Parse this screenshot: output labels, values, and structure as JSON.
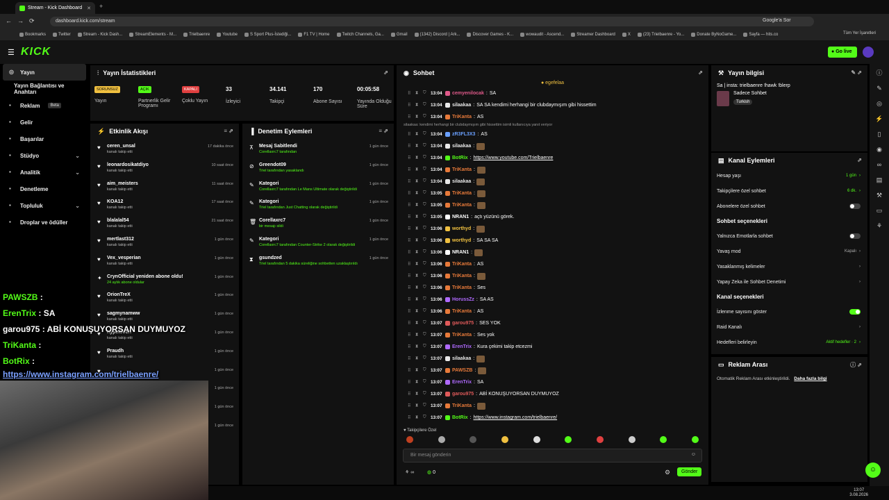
{
  "browser": {
    "tab_title": "Stream - Kick Dashboard",
    "url": "dashboard.kick.com/stream",
    "google_btn": "Google'a Sor",
    "all_bookmarks": "Tüm Yer İşaretleri",
    "bookmarks": [
      "Bookmarks",
      "Twitter",
      "Stream - Kick Dash...",
      "StreamElements - M...",
      "Trielbaenre",
      "Youtube",
      "S Sport Plus-İstediği...",
      "F1 TV | Home",
      "Twitch Channels, Ga...",
      "Gmail",
      "(1342) Discord | Ark...",
      "Discover Games - K...",
      "wowaudit - Ascend...",
      "Streamer Dashboard",
      "X",
      "(23) Trielbaenre - Yo...",
      "Donate ByNoGame...",
      "Sayfa — hits.co"
    ]
  },
  "header": {
    "logo": "KICK",
    "go_live": "Go live"
  },
  "sidebar": {
    "items": [
      {
        "label": "Yayın",
        "icon": "broadcast-icon"
      },
      {
        "label": "Yayın Bağlantısı ve Anahtarı",
        "icon": ""
      },
      {
        "label": "Reklam",
        "badge": "Beta",
        "icon": "ad-icon"
      },
      {
        "label": "Gelir",
        "icon": "wallet-icon"
      },
      {
        "label": "Başarılar",
        "icon": "trophy-icon"
      },
      {
        "label": "Stüdyo",
        "icon": "studio-icon"
      },
      {
        "label": "Analitik",
        "icon": "chart-icon"
      },
      {
        "label": "Denetleme",
        "icon": "shield-icon"
      },
      {
        "label": "Topluluk",
        "icon": "community-icon"
      },
      {
        "label": "Droplar ve ödüller",
        "icon": "gift-icon"
      }
    ]
  },
  "stats": {
    "title": "Yayın İstatistikleri",
    "items": [
      {
        "tag": "SORUNSUZ",
        "label": "Yayın"
      },
      {
        "tag": "AÇIK",
        "label": "Partnerlik Gelir Programı"
      },
      {
        "tag": "KAPALI",
        "label": "Çoklu Yayın"
      },
      {
        "value": "33",
        "label": "İzleyici"
      },
      {
        "value": "34.141",
        "label": "Takipçi"
      },
      {
        "value": "170",
        "label": "Abone Sayısı"
      },
      {
        "value": "00:05:58",
        "label": "Yayında Olduğu Süre"
      }
    ]
  },
  "activity": {
    "title": "Etkinlik Akışı",
    "items": [
      {
        "name": "ceren_unsal",
        "sub": "kanalı takip etti",
        "time": "17 dakika önce"
      },
      {
        "name": "leonardosikatdiyo",
        "sub": "kanalı takip etti",
        "time": "10 saat önce"
      },
      {
        "name": "aim_meisters",
        "sub": "kanalı takip etti",
        "time": "11 saat önce"
      },
      {
        "name": "KOA12",
        "sub": "kanalı takip etti",
        "time": "17 saat önce"
      },
      {
        "name": "blalalal54",
        "sub": "kanalı takip etti",
        "time": "21 saat önce"
      },
      {
        "name": "mertlast312",
        "sub": "kanalı takip etti",
        "time": "1 gün önce"
      },
      {
        "name": "Vex_vesperian",
        "sub": "kanalı takip etti",
        "time": "1 gün önce"
      },
      {
        "name": "CrynOfficial yeniden abone oldu!",
        "sub": "24 aylık abone oldular",
        "time": "1 gün önce"
      },
      {
        "name": "OrionTreX",
        "sub": "kanalı takip etti",
        "time": "1 gün önce"
      },
      {
        "name": "sagmynamww",
        "sub": "kanalı takip etti",
        "time": "1 gün önce"
      },
      {
        "name": "hypeloveri",
        "sub": "kanalı takip etti",
        "time": "1 gün önce"
      },
      {
        "name": "Praudh",
        "sub": "kanalı takip etti",
        "time": "1 gün önce"
      },
      {
        "name": "",
        "sub": "",
        "time": "1 gün önce"
      },
      {
        "name": "",
        "sub": "",
        "time": "1 gün önce"
      },
      {
        "name": "",
        "sub": "",
        "time": "1 gün önce"
      },
      {
        "name": "",
        "sub": "",
        "time": "1 gün önce"
      }
    ]
  },
  "moderation": {
    "title": "Denetim Eylemleri",
    "items": [
      {
        "title": "Mesaj Sabitlendi",
        "sub": "Corellaxrc7 tarafından",
        "time": "1 gün önce"
      },
      {
        "title": "Greendot09",
        "sub": "Triel tarafından yasaklandı",
        "time": "1 gün önce"
      },
      {
        "title": "Kategori",
        "sub": "Corellaxrc7 tarafından Le Mans Ultimate olarak değiştirildi",
        "time": "1 gün önce"
      },
      {
        "title": "Kategori",
        "sub": "Triel tarafından Just Chatting olarak değiştirildi",
        "time": "1 gün önce"
      },
      {
        "title": "Corellaxrc7",
        "sub": "bir mesajı sildi",
        "time": "1 gün önce"
      },
      {
        "title": "Kategori",
        "sub": "Corellaxrc7 tarafından Counter-Strike 2 olarak değiştirildi",
        "time": "1 gün önce"
      },
      {
        "title": "gsundzed",
        "sub": "Triel tarafından 5 dakika süreliğine sohbetten uzaklaştırıldı",
        "time": "1 gün önce"
      }
    ]
  },
  "chat": {
    "title": "Sohbet",
    "pinned_user": "egefelaa",
    "reply_note": "silaakaa: kendimi herhangi bir clubdaymışım gibi hissettim isimli kullanıcıya yanıt veriyor",
    "placeholder": "Bir mesaj gönderin",
    "send": "Gönder",
    "followers_label": "Takipçilere Özel",
    "count": "0",
    "messages": [
      {
        "time": "13:04",
        "user": "cemyenilocak",
        "color": "#e05a8a",
        "text": "SA"
      },
      {
        "time": "13:04",
        "user": "silaakaa",
        "color": "#e8e8e8",
        "text": "SA SA  kendimi herhangi bir clubdaymışım gibi hissettim"
      },
      {
        "time": "13:04",
        "user": "TriKanta",
        "color": "#e87a3a",
        "text": "AS"
      },
      {
        "time": "13:04",
        "user": "zR3FL3X3",
        "color": "#6aa0ff",
        "text": "AS"
      },
      {
        "time": "13:04",
        "user": "silaakaa",
        "color": "#e8e8e8",
        "text": ""
      },
      {
        "time": "13:04",
        "user": "BotRix",
        "color": "#53fc18",
        "text": "https://www.youtube.com/Trielbaenre",
        "link": true
      },
      {
        "time": "13:04",
        "user": "TriKanta",
        "color": "#e87a3a",
        "text": ""
      },
      {
        "time": "13:04",
        "user": "silaakaa",
        "color": "#e8e8e8",
        "text": ""
      },
      {
        "time": "13:05",
        "user": "TriKanta",
        "color": "#e87a3a",
        "text": ""
      },
      {
        "time": "13:05",
        "user": "TriKanta",
        "color": "#e87a3a",
        "text": ""
      },
      {
        "time": "13:05",
        "user": "NRAN1",
        "color": "#ffffff",
        "text": "açtı yüzünü görek."
      },
      {
        "time": "13:06",
        "user": "worthyd",
        "color": "#f0c040",
        "text": ""
      },
      {
        "time": "13:06",
        "user": "worthyd",
        "color": "#f0c040",
        "text": "SA SA SA"
      },
      {
        "time": "13:06",
        "user": "NRAN1",
        "color": "#ffffff",
        "text": ""
      },
      {
        "time": "13:06",
        "user": "TriKanta",
        "color": "#e87a3a",
        "text": "AS"
      },
      {
        "time": "13:06",
        "user": "TriKanta",
        "color": "#e87a3a",
        "text": ""
      },
      {
        "time": "13:06",
        "user": "TriKanta",
        "color": "#e87a3a",
        "text": "Ses"
      },
      {
        "time": "13:06",
        "user": "HorussZz",
        "color": "#b06aff",
        "text": "SA AS"
      },
      {
        "time": "13:06",
        "user": "TriKanta",
        "color": "#e87a3a",
        "text": "AS"
      },
      {
        "time": "13:07",
        "user": "garou975",
        "color": "#e05a5a",
        "text": "SES YOK"
      },
      {
        "time": "13:07",
        "user": "TriKanta",
        "color": "#e87a3a",
        "text": "Ses yok"
      },
      {
        "time": "13:07",
        "user": "ErenTrix",
        "color": "#b06aff",
        "text": "Kura çekimi takip etcezmi"
      },
      {
        "time": "13:07",
        "user": "silaakaa",
        "color": "#e8e8e8",
        "text": ""
      },
      {
        "time": "13:07",
        "user": "PAWSZB",
        "color": "#e87a3a",
        "text": ""
      },
      {
        "time": "13:07",
        "user": "ErenTrix",
        "color": "#b06aff",
        "text": "SA"
      },
      {
        "time": "13:07",
        "user": "garou975",
        "color": "#e05a5a",
        "text": "ABİ KONUŞUYORSAN DUYMUYOZ"
      },
      {
        "time": "13:07",
        "user": "TriKanta",
        "color": "#e87a3a",
        "text": ""
      },
      {
        "time": "13:07",
        "user": "BotRix",
        "color": "#53fc18",
        "text": "https://www.instagram.com/trielbaenre/",
        "link": true
      }
    ]
  },
  "info": {
    "title": "Yayın bilgisi",
    "stream_title": "Sa | insta: trielbaenre !hawk !blerp",
    "tag": "Sadece Sohbet",
    "lang": "Turkish"
  },
  "channel": {
    "title": "Kanal Eylemleri",
    "rows": [
      {
        "label": "Hesap yaşı",
        "value": "1 gün"
      },
      {
        "label": "Takipçilere özel sohbet",
        "value": "6 dk."
      },
      {
        "label": "Abonelere özel sohbet",
        "toggle": "off"
      }
    ],
    "chat_section": "Sohbet seçenekleri",
    "chat_rows": [
      {
        "label": "Yalnızca Emotlarla sohbet",
        "toggle": "off"
      },
      {
        "label": "Yavaş mod",
        "value": "Kapalı"
      },
      {
        "label": "Yasaklanmış kelimeler",
        "value": ""
      },
      {
        "label": "Yapay Zeka ile Sohbet Denetimi",
        "value": ""
      }
    ],
    "channel_section": "Kanal seçenekleri",
    "channel_rows": [
      {
        "label": "İzlenme sayısını göster",
        "toggle": "on"
      },
      {
        "label": "Raid Kanalı",
        "value": ""
      },
      {
        "label": "Hedefleri belirleyin",
        "value": "Aktif hedefler · 2"
      }
    ]
  },
  "ads": {
    "title": "Reklam Arası",
    "text": "Otomatik Reklam Arası etkinleştirildi.",
    "link": "Daha fazla bilgi"
  },
  "overlay": [
    {
      "user": "PAWSZB",
      "color": "#53fc18",
      "text": ""
    },
    {
      "user": "ErenTrix",
      "color": "#53fc18",
      "text": "SA"
    },
    {
      "user": "garou975",
      "color": "#ffffff",
      "text": "ABİ KONUŞUYORSAN DUYMUYOZ"
    },
    {
      "user": "TriKanta",
      "color": "#53fc18",
      "text": ""
    },
    {
      "user": "BotRix",
      "color": "#53fc18",
      "text": ""
    },
    {
      "user": "",
      "color": "#7aa0ff",
      "text": "https://www.instagram.com/trielbaenre/"
    }
  ],
  "taskbar": {
    "time": "13:07",
    "date": "3.08.2026"
  }
}
